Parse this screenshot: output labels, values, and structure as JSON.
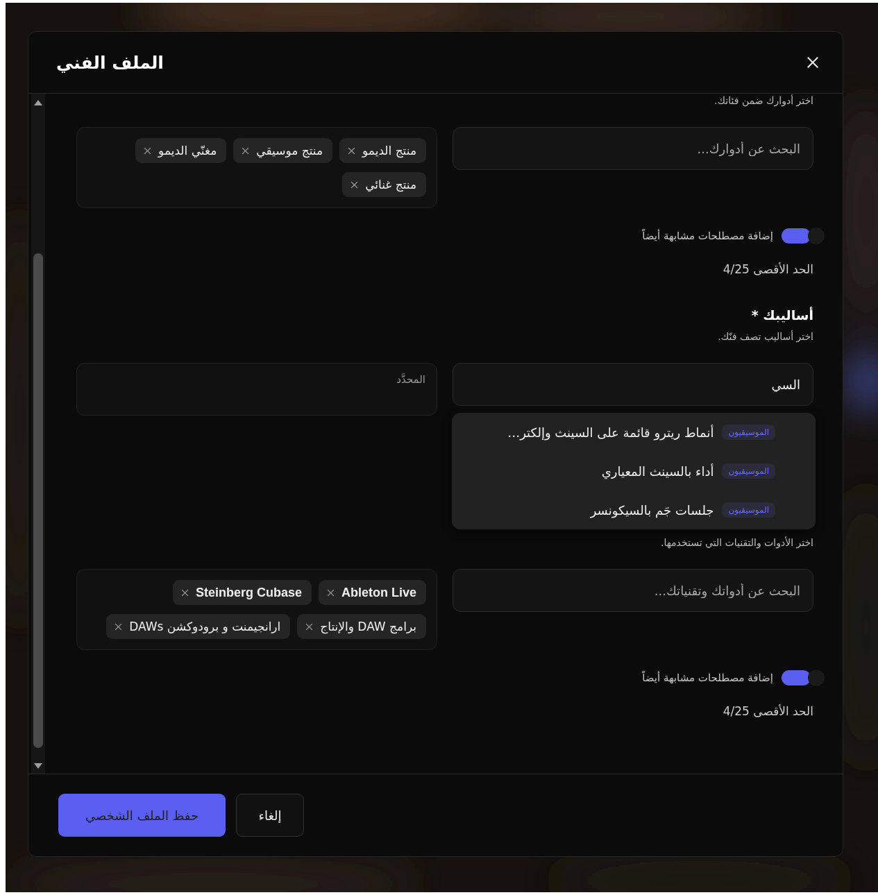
{
  "dialog": {
    "title": "الملف الفني"
  },
  "sections": [
    {
      "hint": "اختر أدوارك ضمن فئاتك.",
      "search": {
        "placeholder": "البحث عن أدوارك..."
      },
      "tags": [
        "منتج الديمو",
        "منتج موسيقي",
        "مغنّي الديمو",
        "منتج غنائي"
      ],
      "similar": {
        "label": "إضافة مصطلحات مشابهة أيضاً",
        "on": true
      },
      "limit": "الحد الأقصى 4/25"
    },
    {
      "label": "أساليبك",
      "required_mark": "*",
      "hint": "اختر أساليب تصف فنّك.",
      "search": {
        "value": "السي"
      },
      "selected_placeholder": "المحدَّد",
      "suggestions": [
        {
          "badge": "الموسيقيون",
          "text": "أنماط ريترو قائمة على السينث وإلكتر…"
        },
        {
          "badge": "الموسيقيون",
          "text": "أداء بالسينث المعياري"
        },
        {
          "badge": "الموسيقيون",
          "text": "جلسات جَم بالسيكونسر"
        }
      ]
    },
    {
      "hint": "اختر الأدوات والتقنيات التي تستخدمها.",
      "search": {
        "placeholder": "البحث عن أدواتك وتقنياتك..."
      },
      "tags": [
        "Ableton Live",
        "Steinberg Cubase",
        "برامج DAW والإنتاج",
        "ارانجيمنت و برودوكشن DAWs"
      ],
      "similar": {
        "label": "إضافة مصطلحات مشابهة أيضاً",
        "on": true
      },
      "limit": "الحد الأقصى 4/25"
    }
  ],
  "buttons": [
    {
      "label": "إلغاء",
      "kind": "secondary"
    },
    {
      "label": "حفظ الملف الشخصي",
      "kind": "primary"
    }
  ]
}
